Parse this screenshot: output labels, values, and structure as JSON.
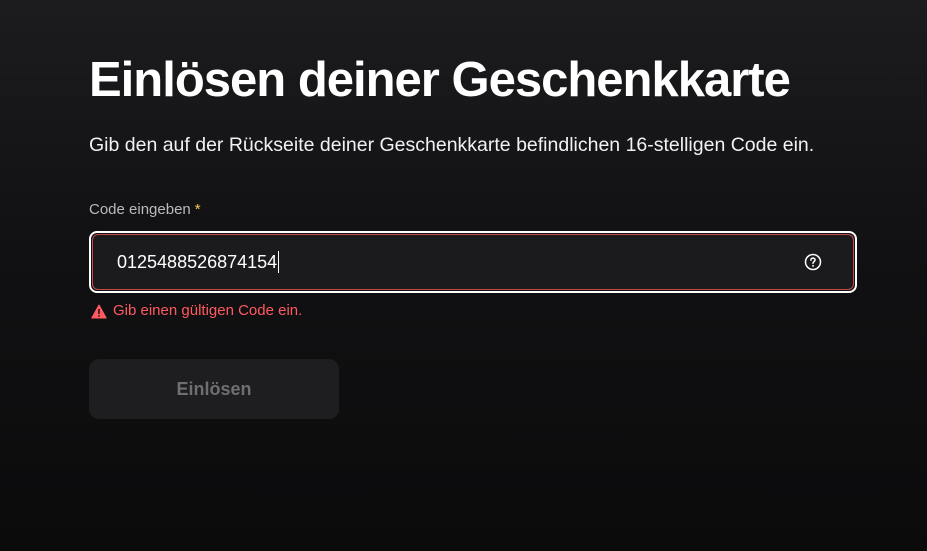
{
  "page": {
    "title": "Einlösen deiner Geschenkkarte",
    "description": "Gib den auf der Rückseite deiner Geschenkkarte befindlichen 16-stelligen Code ein."
  },
  "form": {
    "label": "Code eingeben",
    "required_marker": "*",
    "value": "0125488526874154",
    "error": "Gib einen gültigen Code ein.",
    "submit_label": "Einlösen",
    "submit_disabled": true
  },
  "icons": {
    "help": "help-circle-icon",
    "error": "warning-triangle-icon"
  },
  "colors": {
    "background": "#111113",
    "error": "#ff5a5f",
    "required": "#f4c94b",
    "input_border_focus": "#ffffff",
    "input_border_error": "#c44a4a",
    "button_disabled_bg": "#1e1e20",
    "button_disabled_text": "#6e6e73"
  }
}
